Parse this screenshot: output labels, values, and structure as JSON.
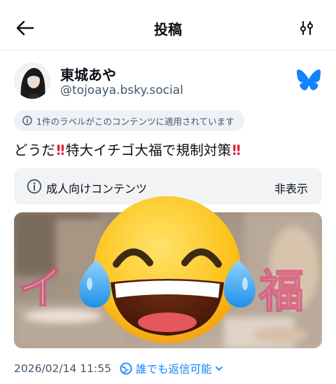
{
  "header": {
    "title": "投稿",
    "back_icon": "arrow-left-icon",
    "filter_icon": "sliders-icon"
  },
  "author": {
    "display_name": "東城あや",
    "handle": "@tojoaya.bsky.social",
    "logo_icon": "bluesky-butterfly-icon",
    "logo_color": "#1083fe"
  },
  "label_notice": {
    "icon": "info-circle-icon",
    "text": "1件のラベルがこのコンテンツに適用されています"
  },
  "post": {
    "text_part1": "どうだ",
    "text_part2": "特大イチゴ大福で規制対策",
    "emphasis_icon": "double-exclamation-icon"
  },
  "content_warning": {
    "icon": "info-circle-icon",
    "label": "成人向けコンテンツ",
    "hide_button": "非表示"
  },
  "media": {
    "overlay_icon": "face-with-tears-of-joy-emoji"
  },
  "meta": {
    "timestamp": "2026/02/14 11:55",
    "reply_setting": "誰でも返信可能",
    "reply_icon": "globe-icon",
    "chevron_icon": "chevron-down-icon",
    "accent_color": "#1083fe"
  }
}
